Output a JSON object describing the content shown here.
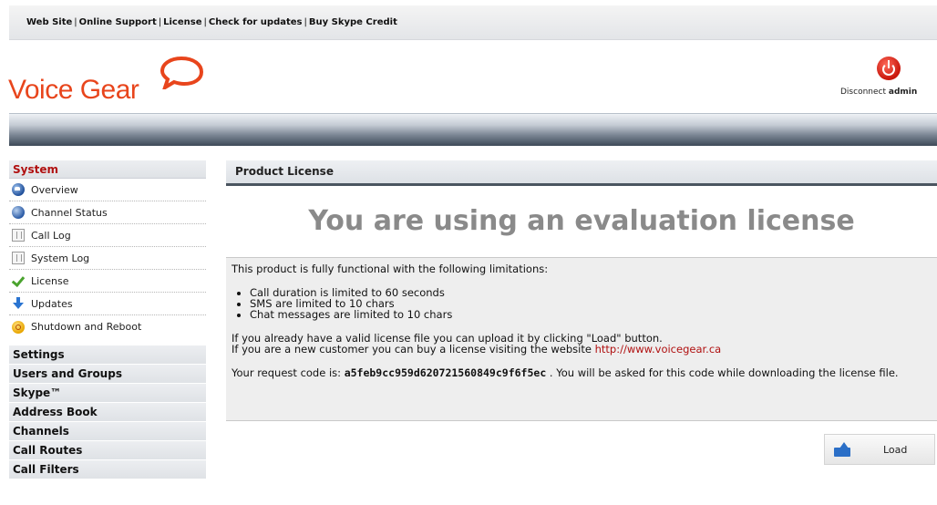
{
  "topbar": {
    "links": [
      "Web Site",
      "Online Support",
      "License",
      "Check for updates",
      "Buy Skype Credit"
    ]
  },
  "header": {
    "logo_text": "Voice Gear",
    "disconnect_label": "Disconnect",
    "user": "admin"
  },
  "sidebar": {
    "system_title": "System",
    "items": [
      {
        "label": "Overview",
        "icon": "home-globe-icon"
      },
      {
        "label": "Channel Status",
        "icon": "globe-icon"
      },
      {
        "label": "Call Log",
        "icon": "log-icon"
      },
      {
        "label": "System Log",
        "icon": "log-icon"
      },
      {
        "label": "License",
        "icon": "checkmark-icon"
      },
      {
        "label": "Updates",
        "icon": "download-arrow-icon"
      },
      {
        "label": "Shutdown and Reboot",
        "icon": "power-icon"
      }
    ],
    "categories": [
      "Settings",
      "Users and Groups",
      "Skype™",
      "Address Book",
      "Channels",
      "Call Routes",
      "Call Filters"
    ]
  },
  "main": {
    "title": "Product License",
    "heading": "You are using an evaluation license",
    "intro": "This product is fully functional with the following limitations:",
    "limitations": [
      "Call duration is limited to 60 seconds",
      "SMS are limited to 10 chars",
      "Chat messages are limited to 10 chars"
    ],
    "upload_text": "If you already have a valid license file you can upload it by clicking \"Load\" button.",
    "buy_text": "If you are a new customer you can buy a license visiting the website",
    "buy_link": "http://www.voicegear.ca",
    "request_prefix": "Your request code is:",
    "request_code": "a5feb9cc959d620721560849c9f6f5ec",
    "request_suffix": ". You will be asked for this code while downloading the license file.",
    "load_button": "Load"
  },
  "colors": {
    "brand": "#e8451c",
    "system_title": "#b01010",
    "link": "#b01010"
  }
}
